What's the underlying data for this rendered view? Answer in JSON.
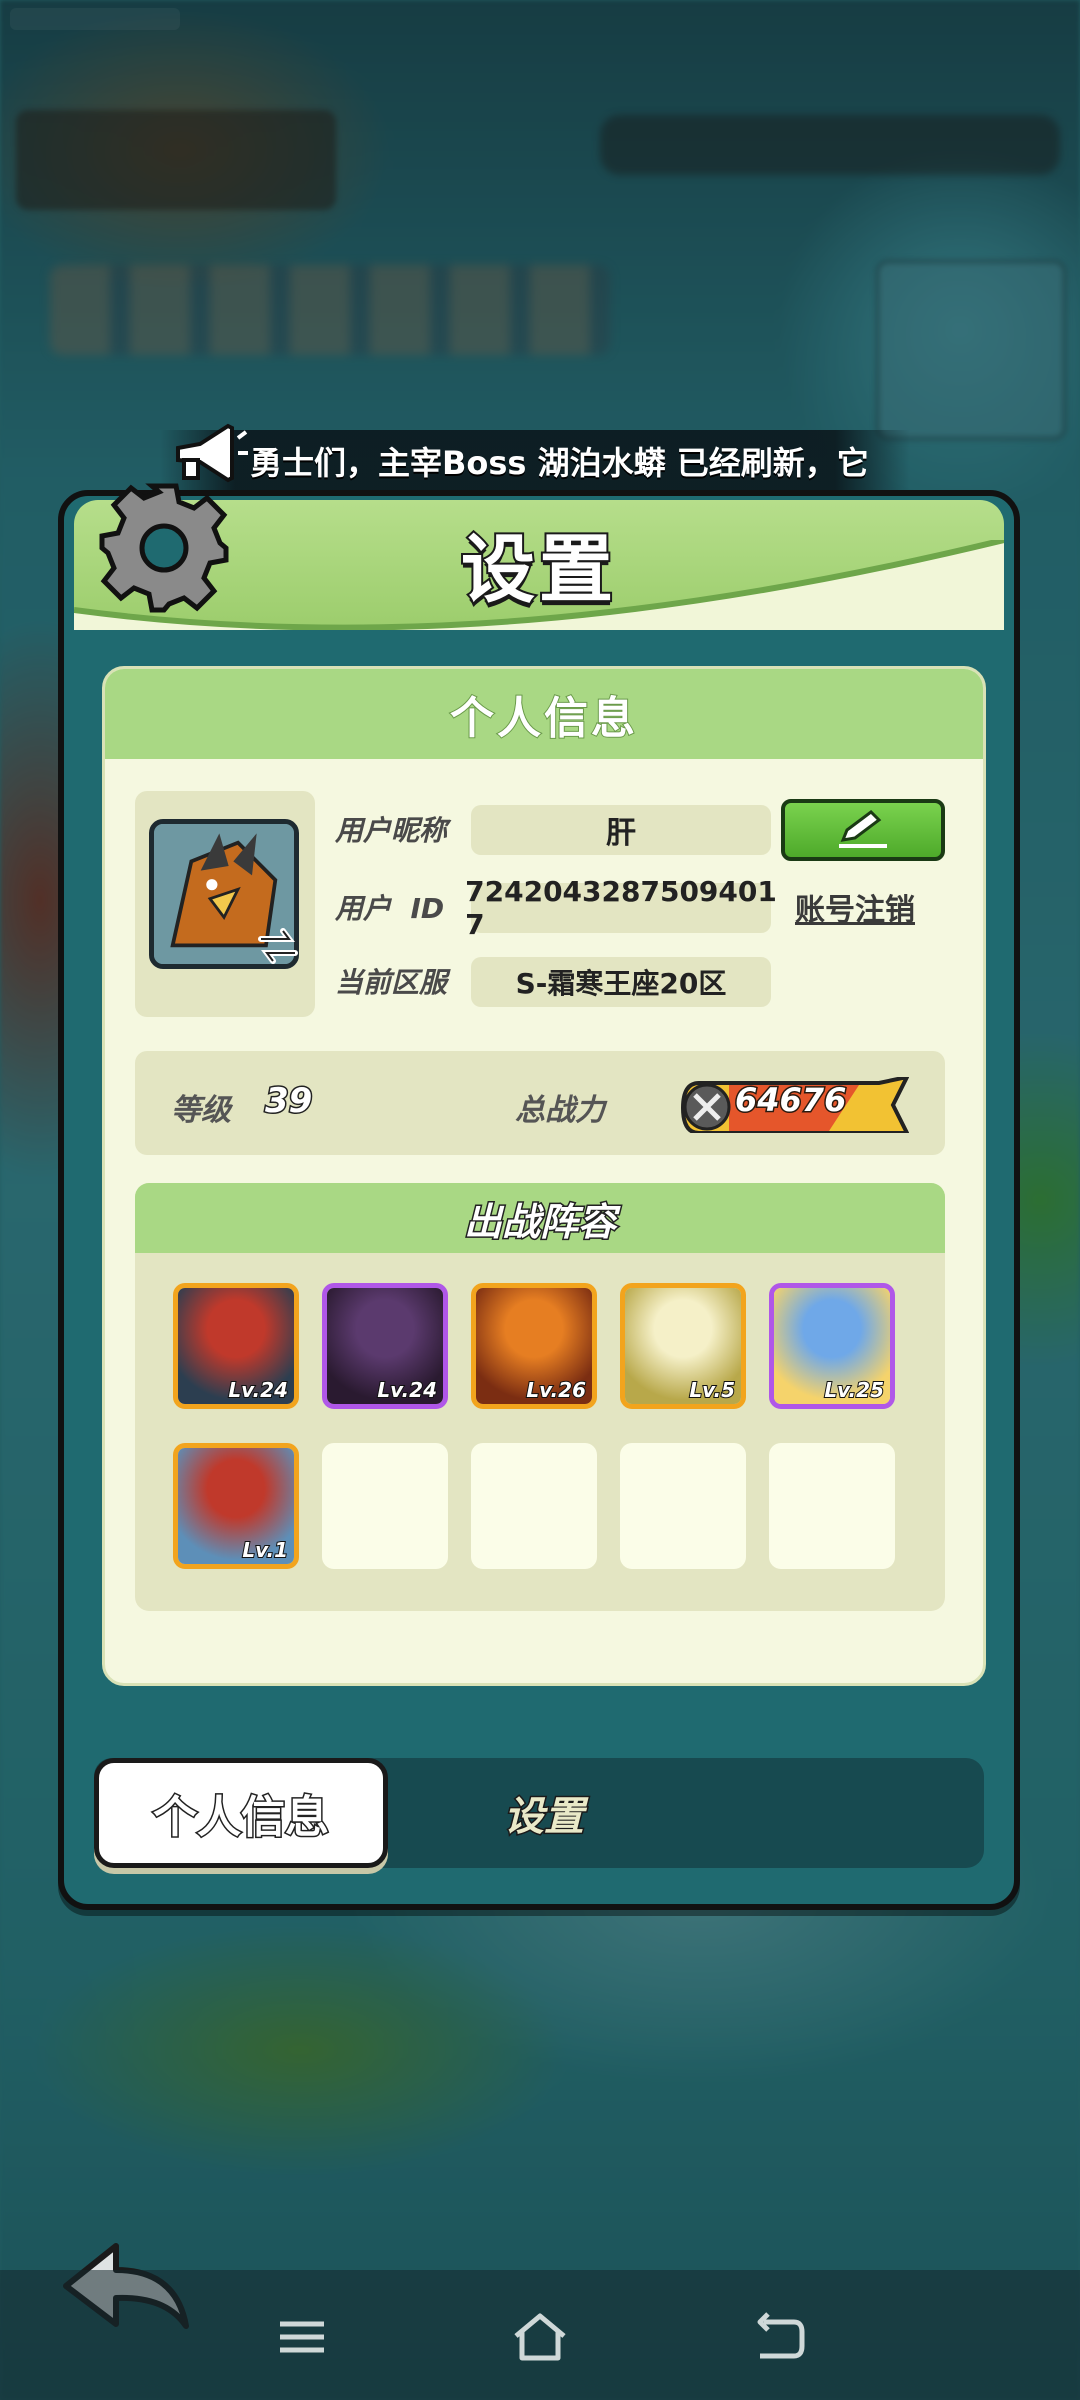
{
  "marquee": {
    "text": "勇士们，主宰Boss 湖泊水蟒 已经刷新，它"
  },
  "panel": {
    "title": "设置"
  },
  "info_card": {
    "title": "个人信息",
    "nickname_label": "用户昵称",
    "nickname": "肝",
    "user_id_label": "用户  ID",
    "user_id": "7242043287509401​7",
    "server_label": "当前区服",
    "server": "S-霜寒王座20区",
    "deregister_label": "账号注销",
    "level_label": "等级",
    "level": "39",
    "power_label": "总战力",
    "power": "64676"
  },
  "lineup": {
    "title": "出战阵容",
    "heroes": [
      {
        "level": "Lv.24",
        "rarity": "orange",
        "colors": [
          "#c0392b",
          "#2c3e50"
        ]
      },
      {
        "level": "Lv.24",
        "rarity": "purple",
        "colors": [
          "#5b3a6e",
          "#2a1a30"
        ]
      },
      {
        "level": "Lv.26",
        "rarity": "orange",
        "colors": [
          "#e67e22",
          "#7b2d12"
        ]
      },
      {
        "level": "Lv.5",
        "rarity": "orange",
        "colors": [
          "#f5f0c8",
          "#b8a84a"
        ]
      },
      {
        "level": "Lv.25",
        "rarity": "purple",
        "colors": [
          "#6fa8e8",
          "#f5d36b"
        ]
      },
      {
        "level": "Lv.1",
        "rarity": "orange",
        "colors": [
          "#c0392b",
          "#5d8fb8"
        ]
      }
    ]
  },
  "tabs": {
    "active": "个人信息",
    "inactive": "设置"
  },
  "colors": {
    "panel_bg": "#1f6a70",
    "header_green": "#9ccd6c",
    "card_bg": "#f5f8e0",
    "edit_button": "#4eaa2a",
    "orange_rarity": "#f2a41d",
    "purple_rarity": "#b057e8"
  }
}
